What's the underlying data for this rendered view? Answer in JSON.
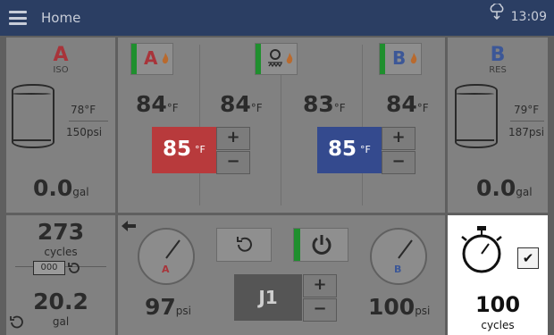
{
  "header": {
    "title": "Home",
    "time": "13:09"
  },
  "tank_a": {
    "letter": "A",
    "label": "ISO",
    "temp": "78",
    "temp_unit": "°F",
    "pressure": "150",
    "pressure_unit": "psi",
    "volume": "0.0",
    "volume_unit": "gal"
  },
  "tank_b": {
    "letter": "B",
    "label": "RES",
    "temp": "79",
    "temp_unit": "°F",
    "pressure": "187",
    "pressure_unit": "psi",
    "volume": "0.0",
    "volume_unit": "gal"
  },
  "heaters": {
    "a_letter": "A",
    "b_letter": "B",
    "temps": [
      {
        "value": "84",
        "unit": "°F"
      },
      {
        "value": "84",
        "unit": "°F"
      },
      {
        "value": "83",
        "unit": "°F"
      },
      {
        "value": "84",
        "unit": "°F"
      }
    ],
    "setpoint_a": {
      "value": "85",
      "unit": "°F"
    },
    "setpoint_b": {
      "value": "85",
      "unit": "°F"
    },
    "plus": "+",
    "minus": "−"
  },
  "counter": {
    "cycles": "273",
    "cycles_unit": "cycles",
    "digits": "000",
    "volume": "20.2",
    "volume_unit": "gal"
  },
  "pump": {
    "pressure_a": "97",
    "pressure_b": "100",
    "unit": "psi",
    "gauge_a_letter": "A",
    "gauge_b_letter": "B",
    "job": "J1",
    "plus": "+",
    "minus": "−"
  },
  "timer": {
    "cycles": "100",
    "unit": "cycles",
    "checked": "✔"
  },
  "colors": {
    "red": "#b83a3c",
    "blue": "#344a8e",
    "green": "#1f8f2e",
    "header": "#2b3e63"
  }
}
